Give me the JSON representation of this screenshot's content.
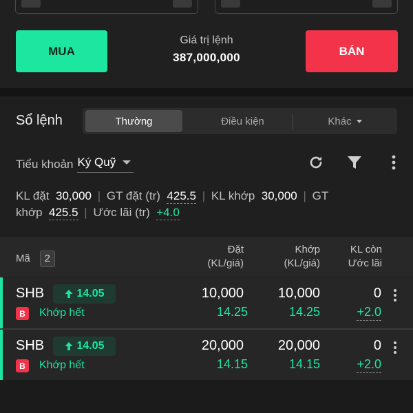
{
  "order_panel": {
    "buy_label": "MUA",
    "sell_label": "BÁN",
    "order_value_label": "Giá trị lệnh",
    "order_value": "387,000,000"
  },
  "order_book": {
    "title": "Sổ lệnh",
    "tabs": [
      {
        "label": "Thường",
        "active": true
      },
      {
        "label": "Điều kiện",
        "active": false
      },
      {
        "label": "Khác",
        "active": false
      }
    ],
    "sub_account_label": "Tiểu khoản",
    "sub_account_value": "Ký Quỹ",
    "icons": [
      "refresh-icon",
      "filter-icon",
      "more-vertical-icon"
    ]
  },
  "summary": {
    "kl_dat_label": "KL đặt",
    "kl_dat_value": "30,000",
    "gt_dat_label": "GT đặt (tr)",
    "gt_dat_value": "425.5",
    "kl_khop_label": "KL khớp",
    "kl_khop_value": "30,000",
    "gt_khop_label_1": "GT",
    "gt_khop_label_2": "khớp",
    "gt_khop_value": "425.5",
    "uoc_lai_label": "Ước lãi (tr)",
    "uoc_lai_value": "+4.0"
  },
  "table": {
    "col_ma": "Mã",
    "count": "2",
    "col_dat_1": "Đặt",
    "col_dat_2": "(KL/giá)",
    "col_khop_1": "Khớp",
    "col_khop_2": "(KL/giá)",
    "col_kl_1": "KL còn",
    "col_kl_2": "Ước lãi",
    "rows": [
      {
        "symbol": "SHB",
        "change": "14.05",
        "side": "B",
        "status": "Khớp hết",
        "order_qty": "10,000",
        "order_price": "14.25",
        "match_qty": "10,000",
        "match_price": "14.25",
        "remaining": "0",
        "est_profit": "+2.0"
      },
      {
        "symbol": "SHB",
        "change": "14.05",
        "side": "B",
        "status": "Khớp hết",
        "order_qty": "20,000",
        "order_price": "14.15",
        "match_qty": "20,000",
        "match_price": "14.15",
        "remaining": "0",
        "est_profit": "+2.0"
      }
    ]
  },
  "colors": {
    "buy": "#1de6a0",
    "sell": "#f2334a",
    "background": "#1b1b1b",
    "panel": "#262626"
  }
}
